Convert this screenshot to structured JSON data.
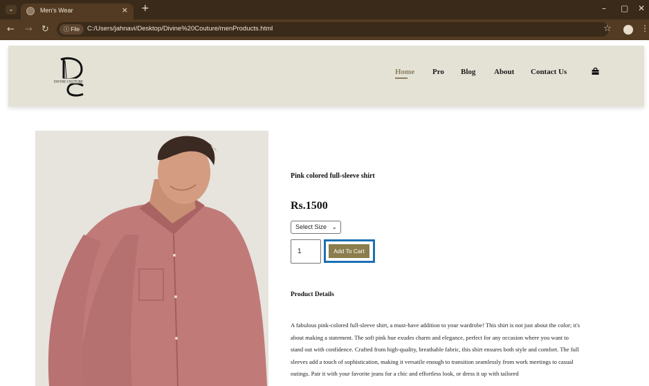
{
  "browser": {
    "tab_title": "Men's Wear",
    "tab_close": "×",
    "new_tab": "+",
    "menu_glyph": "⌄",
    "file_label": "ⓘ File",
    "url": "C:/Users/jahnavi/Desktop/Divine%20Couture/menProducts.html",
    "minimize": "–",
    "maximize": "▢",
    "close": "✕",
    "back": "←",
    "forward": "→",
    "reload": "↻",
    "star": "☆",
    "more": "⋮"
  },
  "site": {
    "logo_text": "DIVINE COUTURE",
    "nav": {
      "home": "Home",
      "pro": "Pro",
      "blog": "Blog",
      "about": "About",
      "contact": "Contact Us"
    }
  },
  "product": {
    "title": "Pink colored full-sleeve shirt",
    "price": "Rs.1500",
    "size_selected": "Select Size",
    "size_caret": "⌄",
    "quantity": "1",
    "add_to_cart": "Add To Cart",
    "details_heading": "Product Details",
    "description": "A fabulous pink-colored full-sleeve shirt, a must-have addition to your wardrobe! This shirt is not just about the color; it's about making a statement. The soft pink hue exudes charm and elegance, perfect for any occasion where you want to stand out with confidence. Crafted from high-quality, breathable fabric, this shirt ensures both style and comfort. The full sleeves add a touch of sophistication, making it versatile enough to transition seamlessly from work meetings to casual outings. Pair it with your favorite jeans for a chic and effortless look, or dress it up with tailored"
  },
  "colors": {
    "browser_dark": "#3a2a19",
    "browser_mid": "#523b22",
    "header_bg": "#e4e2d5",
    "accent": "#8b7d4d",
    "highlight": "#1c6fb3",
    "shirt": "#c27a7a"
  }
}
